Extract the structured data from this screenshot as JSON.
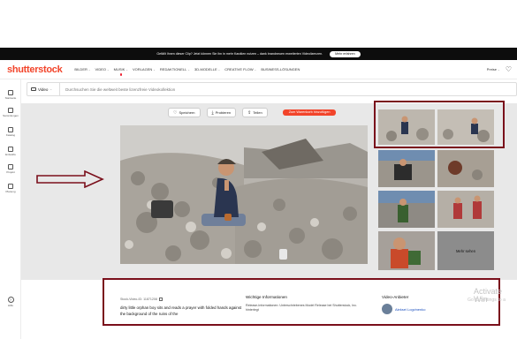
{
  "banner": {
    "text": "Gefällt Ihnen dieser Clip? Jetzt können Sie ihn in mehr Kanälen nutzen – dank brandneuen erweiterten Videolizenzen.",
    "button": "Mehr erfahren"
  },
  "header": {
    "logo": "shutterstock",
    "nav": [
      {
        "label": "BILDER",
        "chevron": true
      },
      {
        "label": "VIDEO",
        "chevron": true
      },
      {
        "label": "MUSIK",
        "chevron": true
      },
      {
        "label": "VORLAGEN",
        "chevron": true
      },
      {
        "label": "REDAKTIONELL",
        "chevron": true
      },
      {
        "label": "3D-MODELLE",
        "chevron": true
      },
      {
        "label": "CREATIVE FLOW",
        "chevron": true
      },
      {
        "label": "BUSINESS-LÖSUNGEN",
        "chevron": false
      }
    ],
    "prices": "Preise",
    "icons": {
      "favorites": "heart-icon",
      "active_indicator_color": "#e82233"
    }
  },
  "sidebar": {
    "items": [
      {
        "label": "Startseite",
        "icon": "home-icon"
      },
      {
        "label": "Sammlungen",
        "icon": "collections-icon"
      },
      {
        "label": "Katalog",
        "icon": "catalog-icon"
      },
      {
        "label": "Entwürfe",
        "icon": "drafts-icon"
      },
      {
        "label": "Projekt",
        "icon": "project-icon"
      },
      {
        "label": "Planung",
        "icon": "planning-icon"
      }
    ],
    "help": "Hilfe"
  },
  "search": {
    "type": "Video",
    "placeholder": "Durchsuchen Sie die weltweit beste lizenzfreie Videokollektion"
  },
  "actions": {
    "save": "Speichern",
    "try": "Probieren",
    "share": "Teilen",
    "wishlist": "Zum Warenkorb hinzufügen"
  },
  "thumbnails": {
    "more": "Mehr sehen"
  },
  "info": {
    "stock_id": "Stock-Video-ID: 11871208",
    "description": "dirty little orphan boy sits and reads a prayer with folded hands against the background of the ruins of the",
    "important_title": "Wichtige Informationen",
    "important_text": "Release-Informationen: Unterschriebenes Model Release bei Shutterstock, Inc. hinterlegt",
    "provider_title": "Video-Anbieter",
    "provider_name": "Aleksei Logvinenko"
  },
  "watermark": {
    "line1": "Activate Win",
    "line2": "Go to Settings to a"
  },
  "colors": {
    "accent": "#f2442a",
    "annotation": "#7a0f1b",
    "link": "#1a4fbf"
  }
}
